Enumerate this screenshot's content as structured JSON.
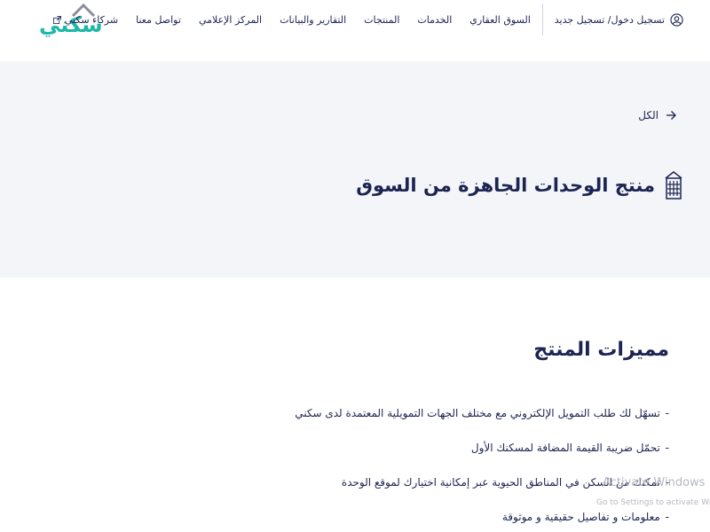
{
  "brand": {
    "logo_text": "سكني"
  },
  "header": {
    "login_label": "تسجيل دخول/ تسجيل جديد",
    "nav_items": [
      {
        "label": "السوق العقاري"
      },
      {
        "label": "الخدمات"
      },
      {
        "label": "المنتجات"
      },
      {
        "label": "التقارير والبيانات"
      },
      {
        "label": "المركز الإعلامي"
      },
      {
        "label": "تواصل معنا"
      },
      {
        "label": "شركاء سكني"
      }
    ]
  },
  "breadcrumb": {
    "label": "الكل"
  },
  "page": {
    "title": "منتج الوحدات الجاهزة من السوق"
  },
  "features": {
    "title": "مميزات المنتج",
    "items": [
      "تسهّل لك طلب التمويل الإلكتروني مع مختلف الجهات التمويلية المعتمدة لدى سكني",
      "تحمّل ضريبة القيمة المضافة لمسكنك الأول",
      "تمكنك من السكن في المناطق الحيوية عبر إمكانية اختيارك لموقع الوحدة",
      "معلومات و تفاصيل حقيقية و موثوقة"
    ],
    "bullet": "-"
  },
  "watermark": {
    "line1": "Activate Windows",
    "line2": "Go to Settings to activate Windows."
  },
  "colors": {
    "brand_teal": "#1fb7a6",
    "text_navy": "#1c2452",
    "hero_bg": "#f4f5f8",
    "logo_roof": "#8a8f99"
  }
}
